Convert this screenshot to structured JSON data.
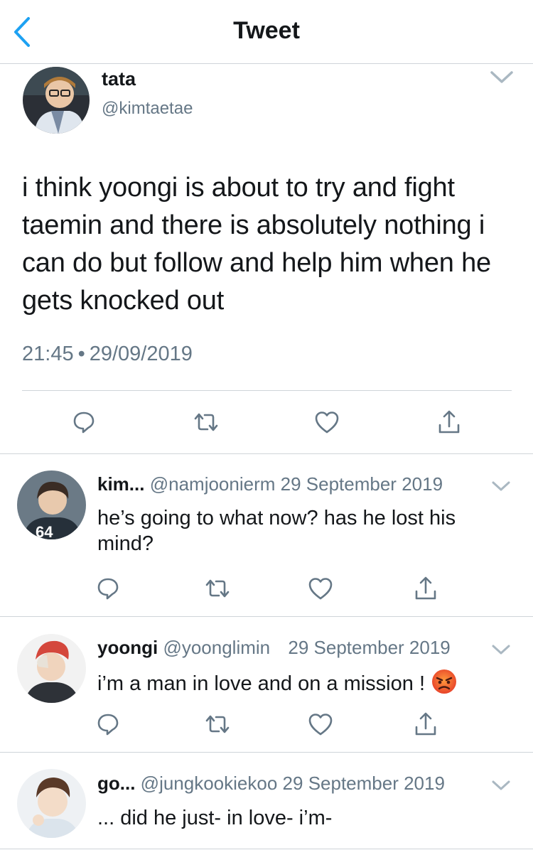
{
  "header": {
    "title": "Tweet",
    "back_icon": "chevron-left-icon"
  },
  "main_tweet": {
    "name": "tata",
    "handle": "@kimtaetae",
    "text": "i think yoongi is about to try and fight taemin and there is absolutely nothing i can do but follow and help him when he gets knocked out",
    "time": "21:45",
    "separator": "•",
    "date": "29/09/2019",
    "actions": [
      "reply-icon",
      "retweet-icon",
      "like-icon",
      "share-icon"
    ]
  },
  "replies": [
    {
      "name": "kim...",
      "handle": "@namjoonierm",
      "date": "29 September 2019",
      "text": "he’s going to what now? has he lost his mind?"
    },
    {
      "name": "yoongi",
      "handle": "@yoonglimin",
      "date": "29 September 2019",
      "text": "i’m a man in love and on a mission !",
      "emoji": "angry-face-icon"
    },
    {
      "name": "go...",
      "handle": "@jungkookiekoo",
      "date": "29 September 2019",
      "text": "... did he just- in love- i’m-"
    }
  ],
  "colors": {
    "accent": "#1da1f2",
    "text": "#14171a",
    "secondary": "#657786",
    "divider": "#cfd4d9",
    "icon": "#657786"
  }
}
